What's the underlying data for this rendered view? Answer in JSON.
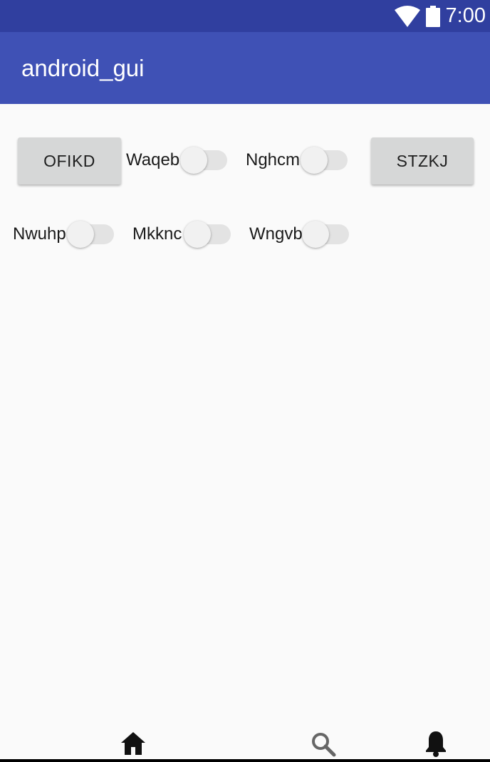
{
  "status_bar": {
    "time": "7:00",
    "icons": [
      "wifi-icon",
      "battery-icon"
    ],
    "color": "#303f9f"
  },
  "app_bar": {
    "title": "android_gui",
    "color": "#3f51b5"
  },
  "buttons": {
    "ofikd": "OFIKD",
    "stzkj": "STZKJ"
  },
  "switches": {
    "waqeb": {
      "label": "Waqeb",
      "checked": false
    },
    "nghcm": {
      "label": "Nghcm",
      "checked": false
    },
    "nwuhp": {
      "label": "Nwuhp",
      "checked": false
    },
    "mkknc": {
      "label": "Mkknc",
      "checked": false
    },
    "wngvb": {
      "label": "Wngvb",
      "checked": false
    }
  },
  "bottom_nav": {
    "items": [
      "home-icon",
      "search-icon",
      "bell-icon"
    ]
  }
}
